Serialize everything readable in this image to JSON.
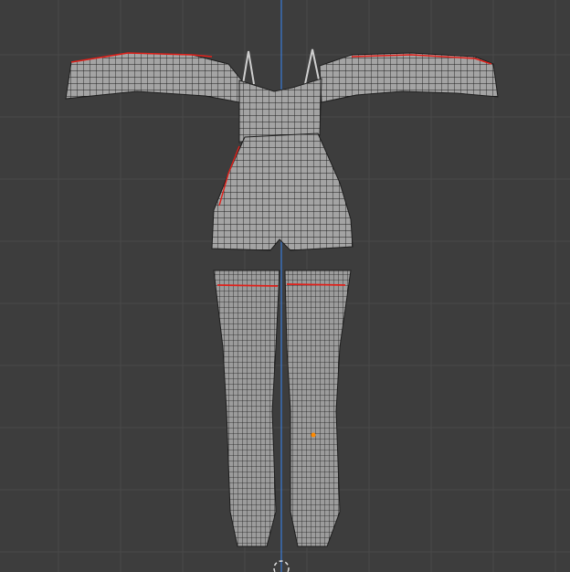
{
  "colors": {
    "background": "#3d3d3d",
    "grid": "#494949",
    "z_axis": "#3a7ad6",
    "mesh_fill": "#9a9a9a",
    "wire": "#1e1e1e",
    "seam": "#e0201a",
    "selected_vertex": "#ff8a00"
  }
}
